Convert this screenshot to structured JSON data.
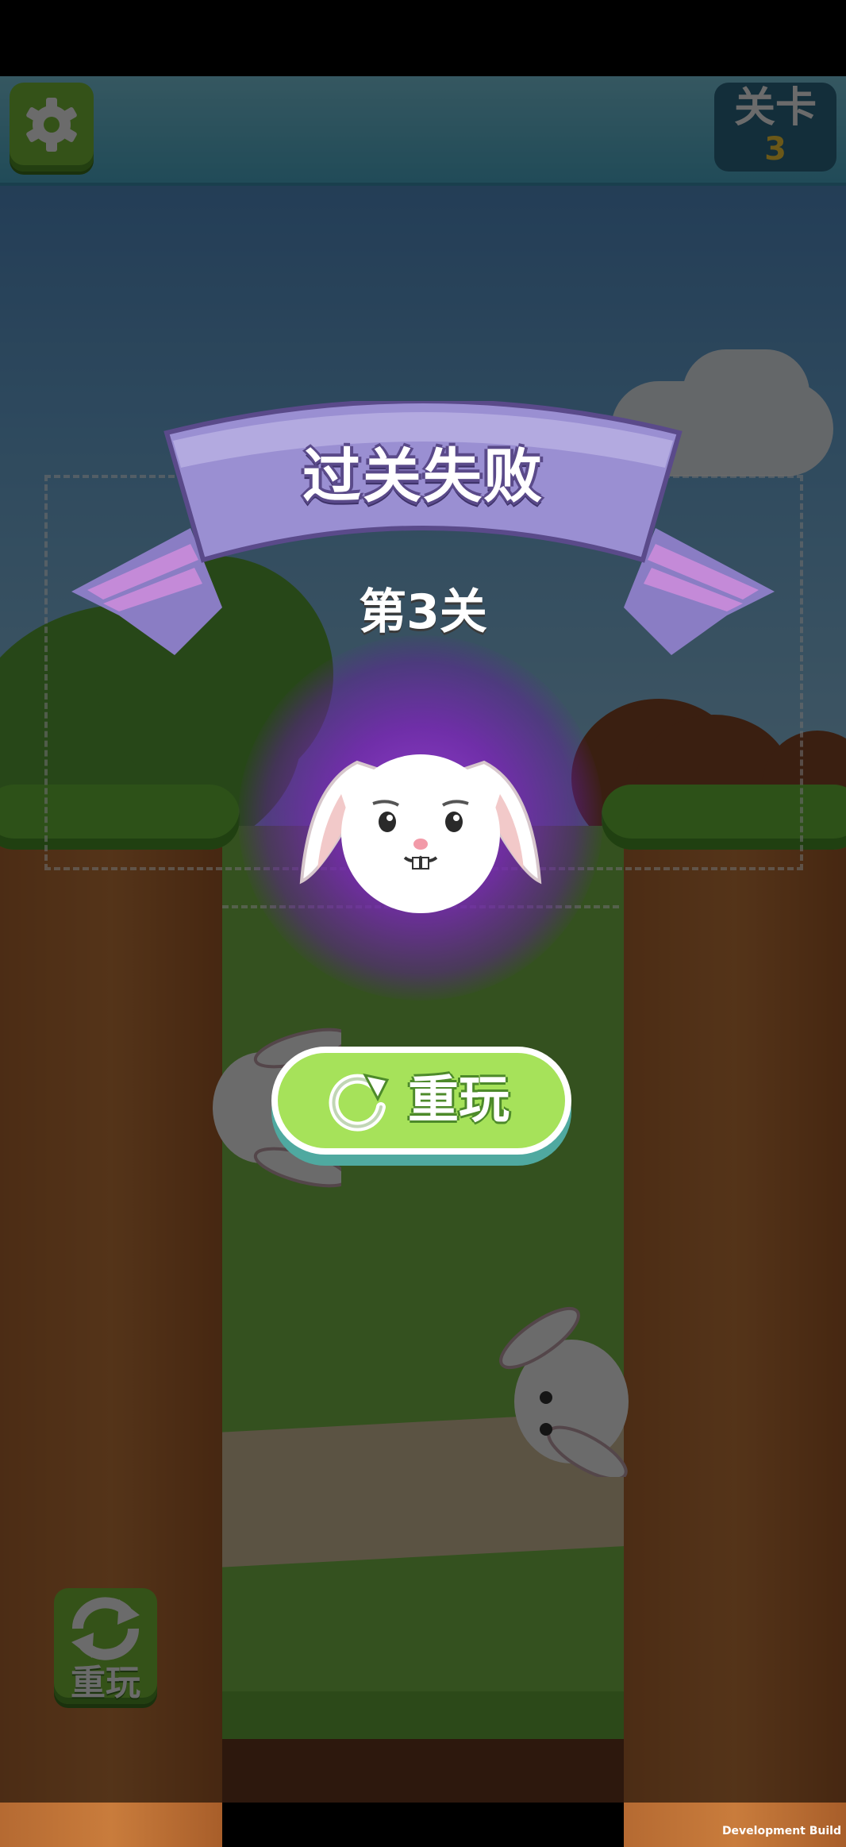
{
  "hud": {
    "level_label": "关卡",
    "level_number": "3",
    "settings_icon": "gear-icon"
  },
  "side_button": {
    "label": "重玩",
    "icon": "refresh-icon"
  },
  "fail_dialog": {
    "title": "过关失败",
    "subtitle": "第3关",
    "replay_label": "重玩",
    "replay_icon": "restart-icon"
  },
  "footer": {
    "build_label": "Development Build"
  },
  "colors": {
    "ribbon": "#8a7dc4",
    "button_green": "#a6e25a",
    "glow_purple": "#8a2fc0"
  }
}
